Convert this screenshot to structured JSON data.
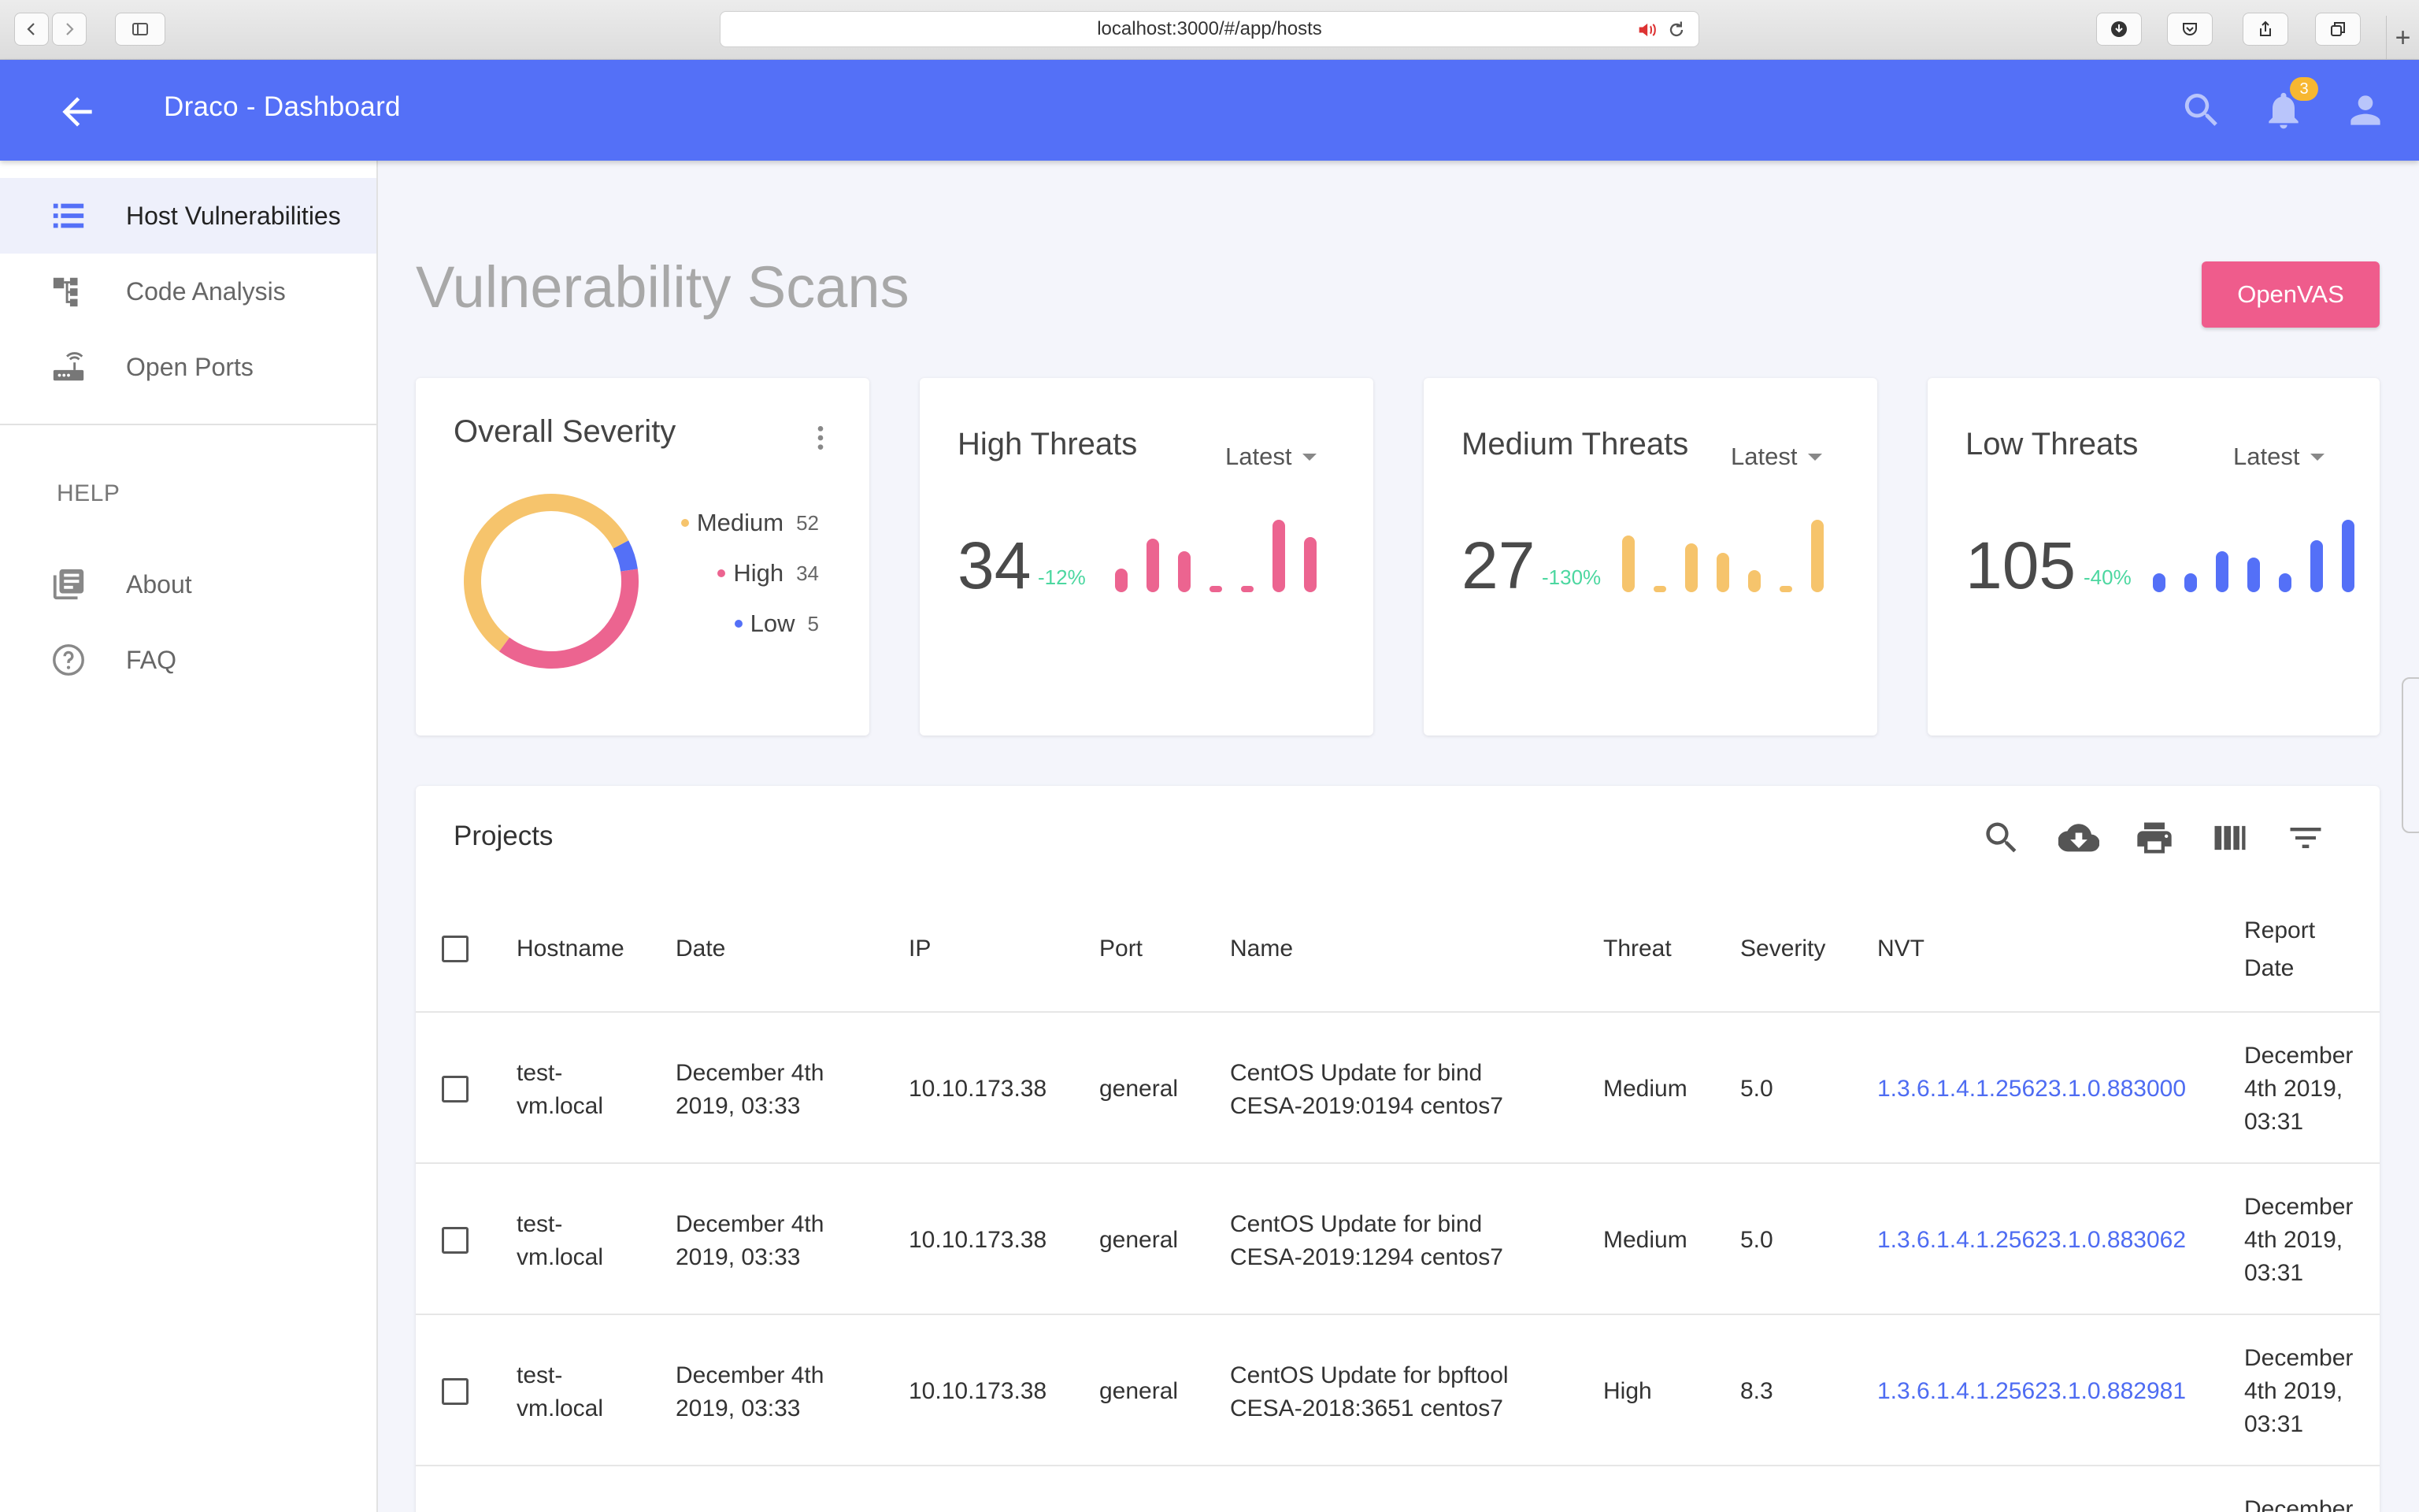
{
  "browser": {
    "url": "localhost:3000/#/app/hosts",
    "new_tab_label": "+"
  },
  "header": {
    "title": "Draco - Dashboard",
    "notification_count": "3",
    "color": "#5470f7"
  },
  "sidebar": {
    "items": [
      {
        "label": "Host Vulnerabilities",
        "icon": "list-icon",
        "active": true
      },
      {
        "label": "Code Analysis",
        "icon": "hierarchy-icon",
        "active": false
      },
      {
        "label": "Open Ports",
        "icon": "router-icon",
        "active": false
      }
    ],
    "help_heading": "HELP",
    "help_items": [
      {
        "label": "About",
        "icon": "book-icon"
      },
      {
        "label": "FAQ",
        "icon": "help-circle-icon"
      }
    ]
  },
  "main": {
    "title": "Vulnerability Scans",
    "openvas_label": "OpenVAS"
  },
  "severity_card": {
    "title": "Overall Severity",
    "legend": [
      {
        "label": "Medium",
        "count": "52",
        "color": "#f6c46c"
      },
      {
        "label": "High",
        "count": "34",
        "color": "#ec6490"
      },
      {
        "label": "Low",
        "count": "5",
        "color": "#5470f7"
      }
    ]
  },
  "threat_cards": [
    {
      "title": "High Threats",
      "filter": "Latest",
      "value": "34",
      "change": "-12%",
      "color": "#ec6490"
    },
    {
      "title": "Medium Threats",
      "filter": "Latest",
      "value": "27",
      "change": "-130%",
      "color": "#f6c46c"
    },
    {
      "title": "Low Threats",
      "filter": "Latest",
      "value": "105",
      "change": "-40%",
      "color": "#5470f7"
    }
  ],
  "projects": {
    "title": "Projects",
    "columns": [
      "Hostname",
      "Date",
      "IP",
      "Port",
      "Name",
      "Threat",
      "Severity",
      "NVT",
      "Report Date"
    ],
    "rows": [
      {
        "hostname": "test-vm.local",
        "date": "December 4th 2019, 03:33",
        "ip": "10.10.173.38",
        "port": "general",
        "name": "CentOS Update for bind CESA-2019:0194 centos7",
        "threat": "Medium",
        "severity": "5.0",
        "nvt": "1.3.6.1.4.1.25623.1.0.883000",
        "report_date": "December 4th 2019, 03:31"
      },
      {
        "hostname": "test-vm.local",
        "date": "December 4th 2019, 03:33",
        "ip": "10.10.173.38",
        "port": "general",
        "name": "CentOS Update for bind CESA-2019:1294 centos7",
        "threat": "Medium",
        "severity": "5.0",
        "nvt": "1.3.6.1.4.1.25623.1.0.883062",
        "report_date": "December 4th 2019, 03:31"
      },
      {
        "hostname": "test-vm.local",
        "date": "December 4th 2019, 03:33",
        "ip": "10.10.173.38",
        "port": "general",
        "name": "CentOS Update for bpftool CESA-2018:3651 centos7",
        "threat": "High",
        "severity": "8.3",
        "nvt": "1.3.6.1.4.1.25623.1.0.882981",
        "report_date": "December 4th 2019, 03:31"
      },
      {
        "report_date": "December"
      }
    ]
  }
}
